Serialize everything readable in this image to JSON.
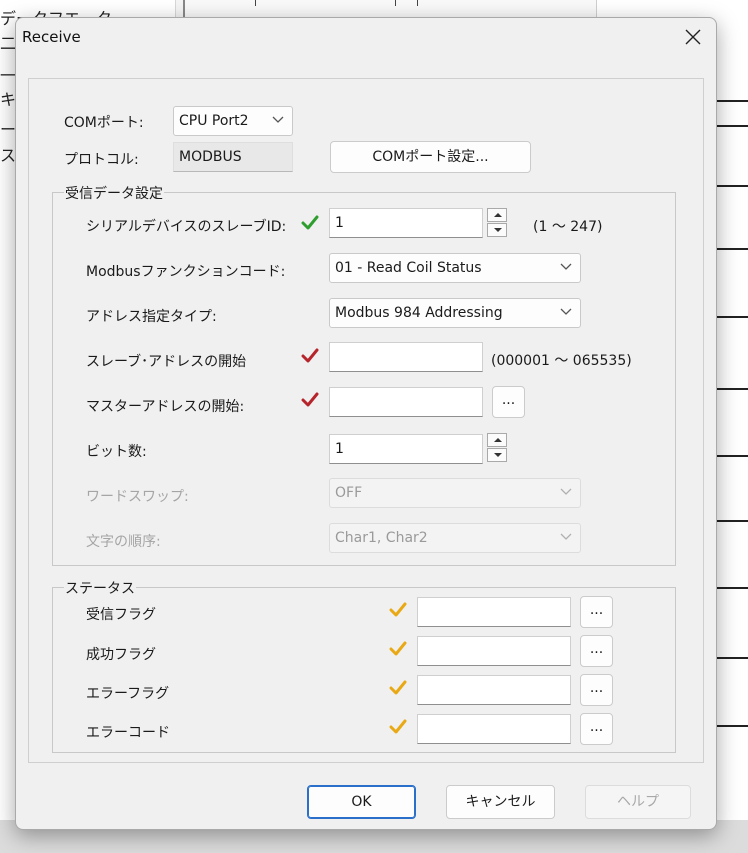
{
  "background": {
    "left_texts": [
      "データフエータ",
      "二",
      "一[ 走",
      "キ",
      "ー ",
      "ス"
    ]
  },
  "dialog": {
    "title": "Receive",
    "close_icon": "close-icon",
    "com_port_label": "COMポート:",
    "com_port_value": "CPU Port2",
    "protocol_label": "プロトコル:",
    "protocol_value": "MODBUS",
    "com_settings_button": "COMポート設定...",
    "receive_group": {
      "title": "受信データ設定",
      "slave_id": {
        "label": "シリアルデバイスのスレーブID:",
        "value": "1",
        "range": "(1 ～ 247)",
        "check_color": "#2e9e2e"
      },
      "function_code": {
        "label": "Modbusファンクションコード:",
        "value": "01 - Read Coil Status"
      },
      "address_type": {
        "label": "アドレス指定タイプ:",
        "value": "Modbus 984 Addressing"
      },
      "slave_start": {
        "label": "スレーブ･アドレスの開始",
        "value": "",
        "range": "(000001 ～ 065535)",
        "check_color": "#b5252b"
      },
      "master_start": {
        "label": "マスターアドレスの開始:",
        "value": "",
        "browse": "...",
        "check_color": "#b5252b"
      },
      "bit_count": {
        "label": "ビット数:",
        "value": "1"
      },
      "word_swap": {
        "label": "ワードスワップ:",
        "value": "OFF"
      },
      "char_order": {
        "label": "文字の順序:",
        "value": "Char1, Char2"
      }
    },
    "status_group": {
      "title": "ステータス",
      "check_color": "#e8a915",
      "rows": [
        {
          "label": "受信フラグ",
          "value": "",
          "browse": "..."
        },
        {
          "label": "成功フラグ",
          "value": "",
          "browse": "..."
        },
        {
          "label": "エラーフラグ",
          "value": "",
          "browse": "..."
        },
        {
          "label": "エラーコード",
          "value": "",
          "browse": "..."
        }
      ]
    },
    "buttons": {
      "ok": "OK",
      "cancel": "キャンセル",
      "help": "ヘルプ"
    }
  }
}
